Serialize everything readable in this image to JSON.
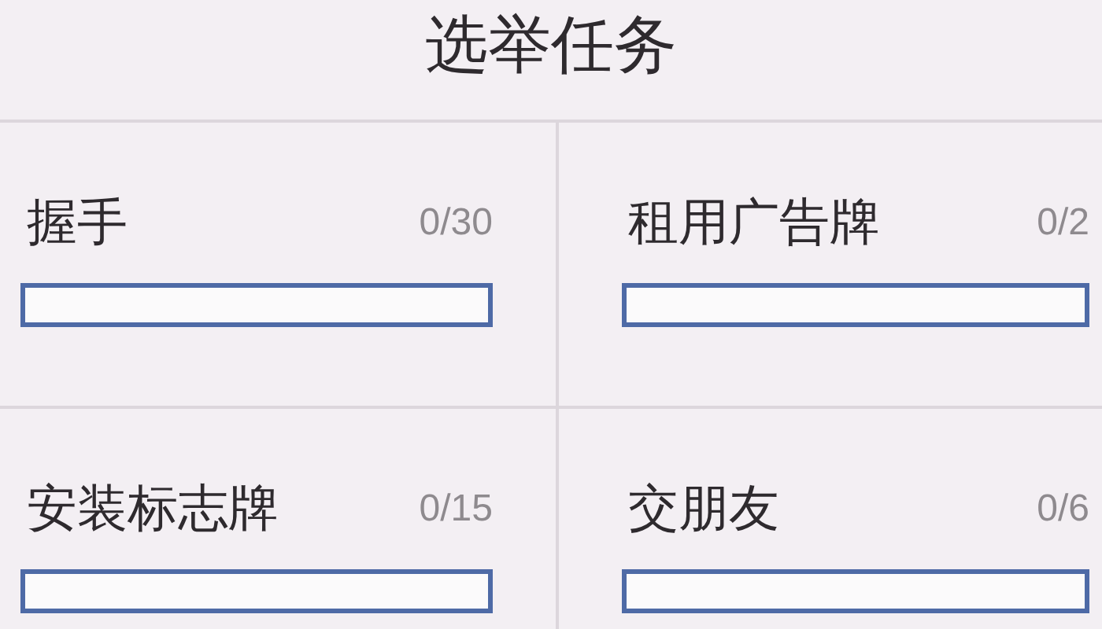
{
  "title": "选举任务",
  "tasks": [
    {
      "name": "握手",
      "count": "0/30"
    },
    {
      "name": "租用广告牌",
      "count": "0/2"
    },
    {
      "name": "安装标志牌",
      "count": "0/15"
    },
    {
      "name": "交朋友",
      "count": "0/6"
    }
  ]
}
